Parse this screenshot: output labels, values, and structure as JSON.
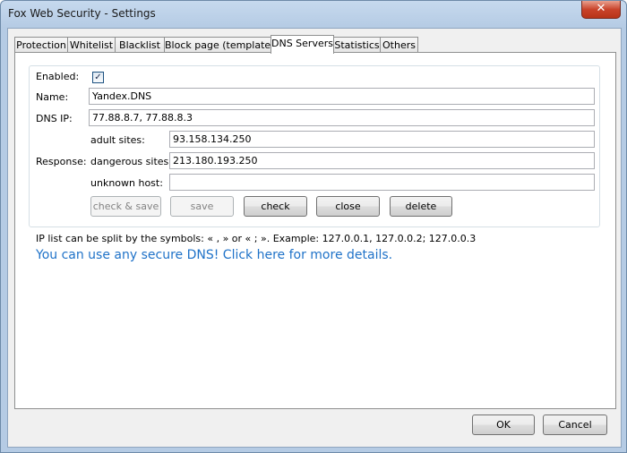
{
  "window": {
    "title": "Fox Web Security - Settings",
    "close_glyph": "✕"
  },
  "tabs": [
    {
      "label": "Protection"
    },
    {
      "label": "Whitelist"
    },
    {
      "label": "Blacklist"
    },
    {
      "label": "Block page (template)"
    },
    {
      "label": "DNS Servers",
      "active": true
    },
    {
      "label": "Statistics"
    },
    {
      "label": "Others"
    }
  ],
  "dns": {
    "enabled_label": "Enabled:",
    "enabled_checked": true,
    "name_label": "Name:",
    "name_value": "Yandex.DNS",
    "ip_label": "DNS IP:",
    "ip_value": "77.88.8.7, 77.88.8.3",
    "response_label": "Response:",
    "adult_label": "adult sites:",
    "adult_value": "93.158.134.250",
    "dangerous_label": "dangerous sites:",
    "dangerous_value": "213.180.193.250",
    "unknown_label": "unknown host:",
    "unknown_value": ""
  },
  "buttons": {
    "check_save": "check & save",
    "save": "save",
    "check": "check",
    "close": "close",
    "delete": "delete"
  },
  "hint": "IP list can be split by the symbols: « , » or « ; ». Example: 127.0.0.1, 127.0.0.2; 127.0.0.3",
  "link": "You can use any secure DNS! Click here for more details.",
  "footer": {
    "ok": "OK",
    "cancel": "Cancel"
  },
  "colors": {
    "link": "#1f72c8",
    "close_button": "#c9442b",
    "frame": "#b5cbe4"
  }
}
